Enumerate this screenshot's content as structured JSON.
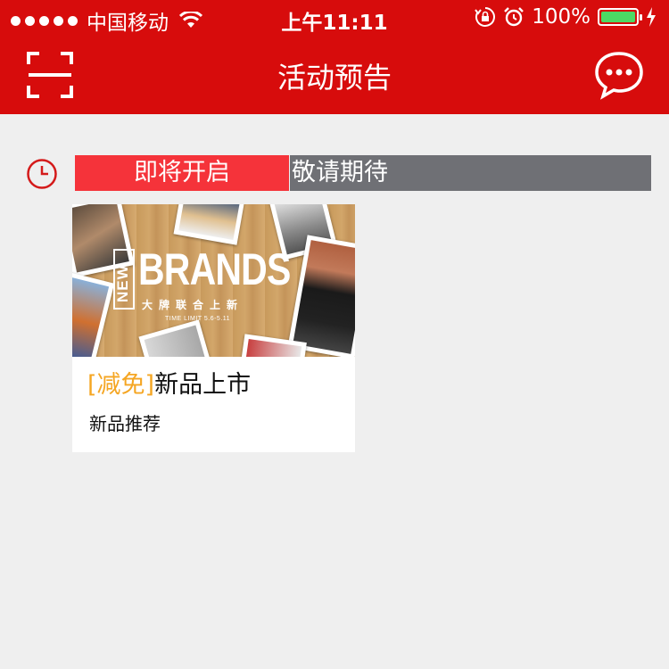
{
  "status_bar": {
    "carrier": "中国移动",
    "time": "上午11:11",
    "battery_percent": "100%",
    "battery_level": 1.0
  },
  "navbar": {
    "title": "活动预告",
    "left_icon": "scan-icon",
    "right_icon": "chat-bubble-icon"
  },
  "tags": {
    "clock_icon": "clock-icon",
    "upcoming_label": "即将开启",
    "waiting_label": "敬请期待"
  },
  "card": {
    "banner": {
      "new_text": "NEW",
      "brands_text": "BRANDS",
      "subtitle": "大牌联合上新",
      "time_limit": "TIME LIMIT  5.6-5.11"
    },
    "title_tag": "[减免]",
    "title": "新品上市",
    "subtitle": "新品推荐"
  },
  "colors": {
    "brand_red": "#d70c0c",
    "tag_red": "#f5333a",
    "tag_gray": "#6f7075",
    "accent_orange": "#f5a623",
    "background": "#efefef"
  }
}
